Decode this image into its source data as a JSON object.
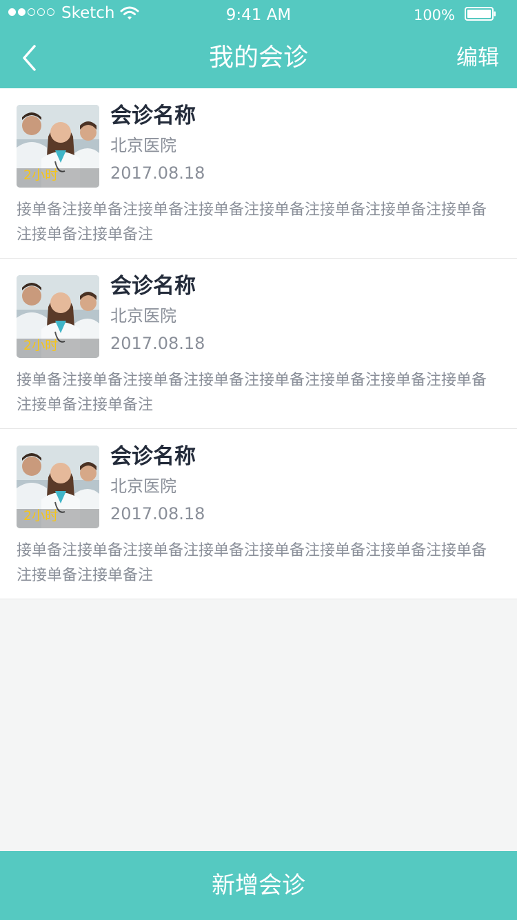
{
  "status_bar": {
    "carrier": "Sketch",
    "time": "9:41 AM",
    "battery_percent": "100%",
    "signal_dots": [
      true,
      true,
      false,
      false,
      false
    ],
    "wifi_icon": "wifi-icon",
    "battery_icon": "battery-icon"
  },
  "nav": {
    "back_icon": "chevron-left-icon",
    "title": "我的会诊",
    "edit_label": "编辑"
  },
  "consultations": [
    {
      "title": "会诊名称",
      "hospital": "北京医院",
      "date": "2017.08.18",
      "duration": "2小时",
      "note": "接单备注接单备注接单备注接单备注接单备注接单备注接单备注接单备注接单备注接单备注"
    },
    {
      "title": "会诊名称",
      "hospital": "北京医院",
      "date": "2017.08.18",
      "duration": "2小时",
      "note": "接单备注接单备注接单备注接单备注接单备注接单备注接单备注接单备注接单备注接单备注"
    },
    {
      "title": "会诊名称",
      "hospital": "北京医院",
      "date": "2017.08.18",
      "duration": "2小时",
      "note": "接单备注接单备注接单备注接单备注接单备注接单备注接单备注接单备注接单备注接单备注"
    }
  ],
  "bottom": {
    "add_label": "新增会诊"
  },
  "colors": {
    "accent": "#55c9c1",
    "title_text": "#232b3a",
    "secondary_text": "#8a8f99",
    "duration_text": "#f5c518",
    "background": "#f4f5f5"
  }
}
